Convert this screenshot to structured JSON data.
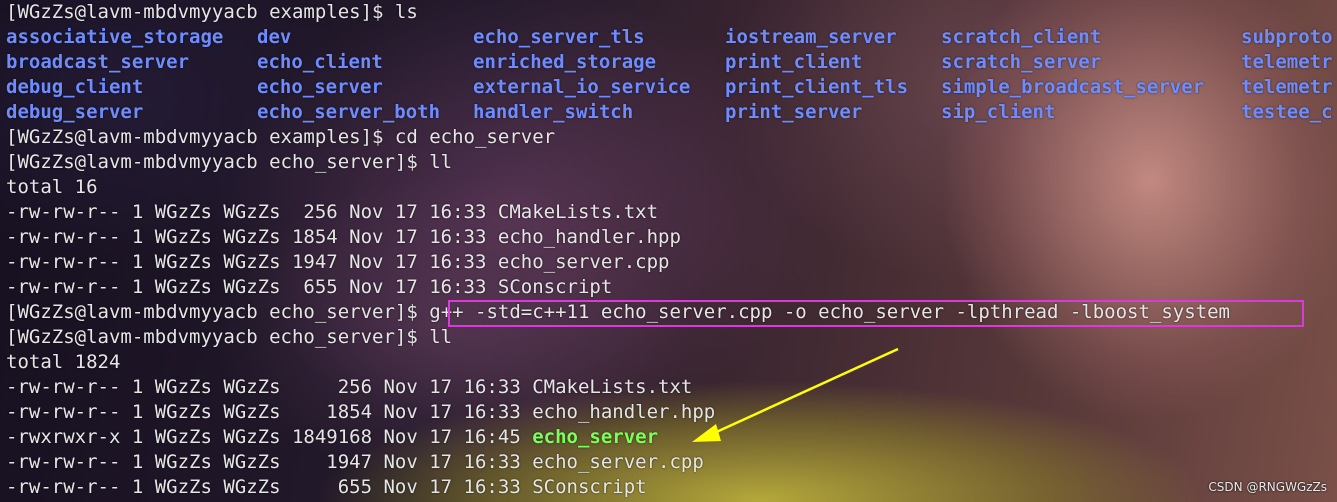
{
  "terminal": {
    "prompt_examples_ls": "[WGzZs@lavm-mbdvmyyacb examples]$ ls",
    "ls_rows": [
      [
        "associative_storage",
        "dev",
        "echo_server_tls",
        "iostream_server",
        "scratch_client",
        "subproto"
      ],
      [
        "broadcast_server",
        "echo_client",
        "enriched_storage",
        "print_client",
        "scratch_server",
        "telemetr"
      ],
      [
        "debug_client",
        "echo_server",
        "external_io_service",
        "print_client_tls",
        "simple_broadcast_server",
        "telemetr"
      ],
      [
        "debug_server",
        "echo_server_both",
        "handler_switch",
        "print_server",
        "sip_client",
        "testee_c"
      ]
    ],
    "prompt_cd": "[WGzZs@lavm-mbdvmyyacb examples]$ cd echo_server",
    "prompt_ll_1": "[WGzZs@lavm-mbdvmyyacb echo_server]$ ll",
    "total_1": "total 16",
    "listing_1": [
      "-rw-rw-r-- 1 WGzZs WGzZs  256 Nov 17 16:33 CMakeLists.txt",
      "-rw-rw-r-- 1 WGzZs WGzZs 1854 Nov 17 16:33 echo_handler.hpp",
      "-rw-rw-r-- 1 WGzZs WGzZs 1947 Nov 17 16:33 echo_server.cpp",
      "-rw-rw-r-- 1 WGzZs WGzZs  655 Nov 17 16:33 SConscript"
    ],
    "prompt_compile": "[WGzZs@lavm-mbdvmyyacb echo_server]$ ",
    "compile_command": "g++ -std=c++11 echo_server.cpp -o echo_server -lpthread -lboost_system",
    "prompt_ll_2": "[WGzZs@lavm-mbdvmyyacb echo_server]$ ll",
    "total_2": "total 1824",
    "listing_2": [
      {
        "prefix": "-rw-rw-r-- 1 WGzZs WGzZs     256 Nov 17 16:33 ",
        "name": "CMakeLists.txt",
        "exe": false
      },
      {
        "prefix": "-rw-rw-r-- 1 WGzZs WGzZs    1854 Nov 17 16:33 ",
        "name": "echo_handler.hpp",
        "exe": false
      },
      {
        "prefix": "-rwxrwxr-x 1 WGzZs WGzZs 1849168 Nov 17 16:45 ",
        "name": "echo_server",
        "exe": true
      },
      {
        "prefix": "-rw-rw-r-- 1 WGzZs WGzZs    1947 Nov 17 16:33 ",
        "name": "echo_server.cpp",
        "exe": false
      },
      {
        "prefix": "-rw-rw-r-- 1 WGzZs WGzZs     655 Nov 17 16:33 ",
        "name": "SConscript",
        "exe": false
      }
    ]
  },
  "annotation": {
    "box_color": "#d93ad9",
    "arrow_color": "#ffff00"
  },
  "watermark": "CSDN @RNGWGzZs"
}
